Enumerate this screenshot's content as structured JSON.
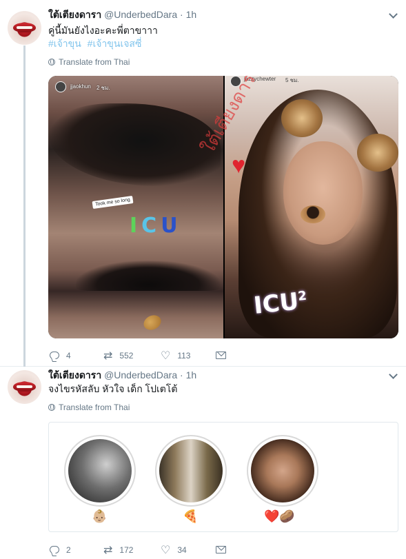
{
  "tweets": [
    {
      "name": "ใต้เตียงดารา",
      "handle": "@UnderbedDara",
      "time": "· 1h",
      "text": "คู่นี้มันยังไงอะคะพี่ตาขาาา",
      "hashtags": [
        "#เจ้าขุน",
        "#เจ้าขุนเจสซี่"
      ],
      "translate": "Translate from Thai",
      "media": {
        "left_user": "jjaokhun",
        "left_time": "2 ชม.",
        "left_caption": "Took me so long",
        "left_sticker": "ICU",
        "right_user": "jazzychewter",
        "right_time": "5 ชม.",
        "right_sticker": "ICU",
        "right_sup": "2",
        "watermark": "ใต้เตียงดารา"
      },
      "actions": {
        "replies": "4",
        "retweets": "552",
        "likes": "113"
      }
    },
    {
      "name": "ใต้เตียงดารา",
      "handle": "@UnderbedDara",
      "time": "· 1h",
      "text": "จงไขรหัสลับ หัวใจ เด็ก โปเตโต้",
      "translate": "Translate from Thai",
      "highlights": [
        {
          "label": "👶🏼"
        },
        {
          "label": "🍕"
        },
        {
          "label": "❤️🥔"
        }
      ],
      "actions": {
        "replies": "2",
        "retweets": "172",
        "likes": "34"
      }
    }
  ],
  "colors": {
    "hashtag": "#80c4ec",
    "muted": "#657786",
    "border": "#e1e8ed",
    "thread": "#ccd6dd"
  }
}
